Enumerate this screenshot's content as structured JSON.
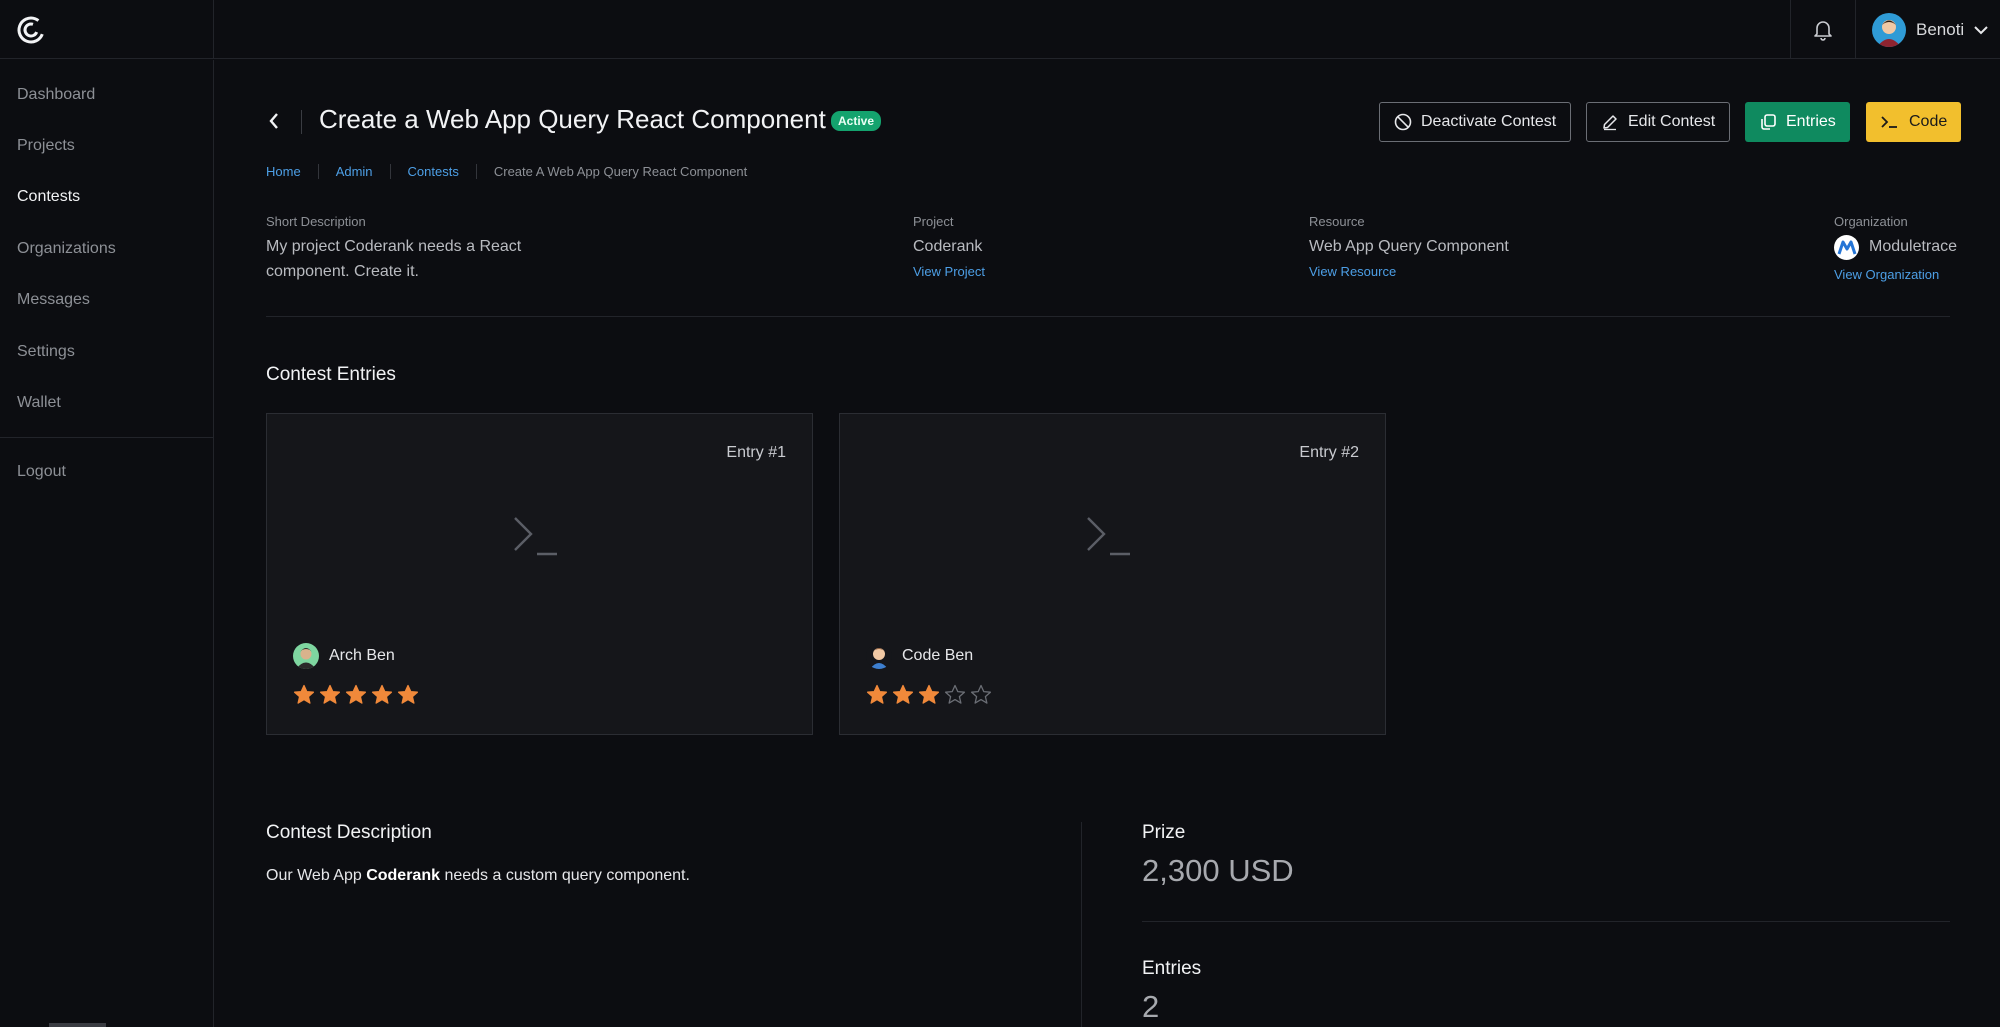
{
  "header": {
    "user_name": "Benoti"
  },
  "sidebar": {
    "items": [
      {
        "label": "Dashboard"
      },
      {
        "label": "Projects"
      },
      {
        "label": "Contests"
      },
      {
        "label": "Organizations"
      },
      {
        "label": "Messages"
      },
      {
        "label": "Settings"
      },
      {
        "label": "Wallet"
      }
    ],
    "logout": "Logout",
    "active": "Contests"
  },
  "page": {
    "title": "Create a Web App Query React Component",
    "status": "Active",
    "actions": {
      "deactivate": "Deactivate Contest",
      "edit": "Edit Contest",
      "entries": "Entries",
      "code": "Code"
    },
    "breadcrumb": [
      "Home",
      "Admin",
      "Contests",
      "Create A Web App Query React Component"
    ]
  },
  "info": {
    "short_description": {
      "label": "Short Description",
      "value": "My project Coderank needs a React component. Create it."
    },
    "project": {
      "label": "Project",
      "value": "Coderank",
      "link": "View Project"
    },
    "resource": {
      "label": "Resource",
      "value": "Web App Query Component",
      "link": "View Resource"
    },
    "organization": {
      "label": "Organization",
      "value": "Moduletrace",
      "link": "View Organization"
    }
  },
  "entries_section": {
    "title": "Contest Entries",
    "entries": [
      {
        "label": "Entry #1",
        "author": "Arch Ben",
        "rating": 5,
        "max_rating": 5
      },
      {
        "label": "Entry #2",
        "author": "Code Ben",
        "rating": 3,
        "max_rating": 5
      }
    ]
  },
  "description": {
    "title": "Contest Description",
    "text_before": "Our Web App ",
    "text_bold": "Coderank",
    "text_after": " needs a custom query component."
  },
  "stats": {
    "prize_label": "Prize",
    "prize_value": "2,300 USD",
    "entries_label": "Entries",
    "entries_value": "2"
  },
  "colors": {
    "background": "#0c0d11",
    "accent_green": "#0f8a5f",
    "accent_yellow": "#f2bf2d",
    "link_blue": "#4d9fe6",
    "star_orange": "#f0893a",
    "badge_green": "#14a36e"
  }
}
